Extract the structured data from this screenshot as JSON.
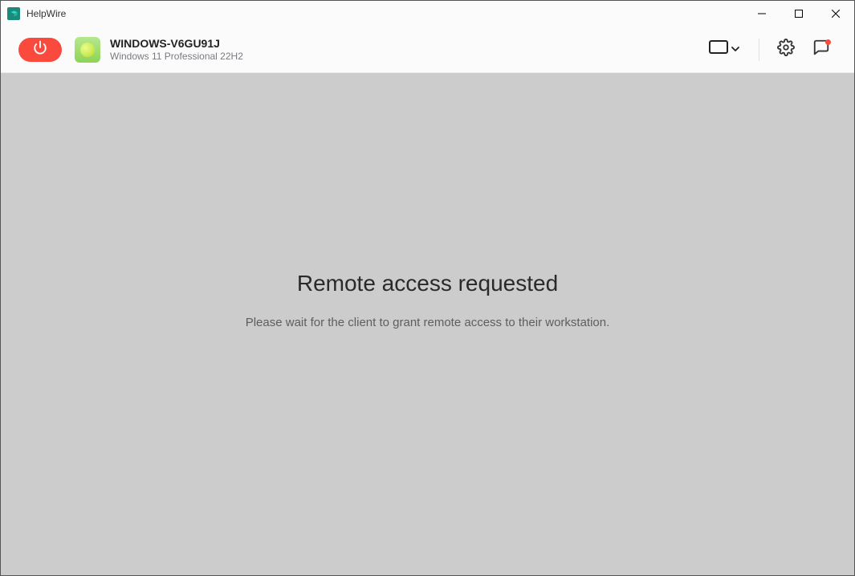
{
  "app": {
    "title": "HelpWire"
  },
  "device": {
    "name": "WINDOWS-V6GU91J",
    "os": "Windows 11 Professional 22H2"
  },
  "main": {
    "title": "Remote access requested",
    "subtitle": "Please wait for the client to grant remote access to their workstation."
  },
  "chat": {
    "has_notification": true
  }
}
